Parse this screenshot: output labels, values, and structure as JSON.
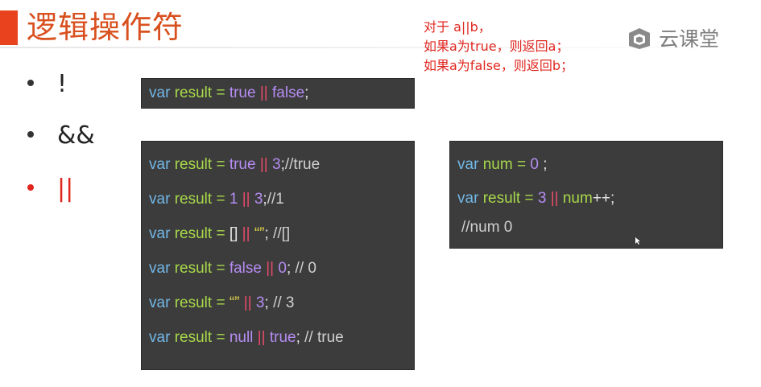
{
  "title": "逻辑操作符",
  "note_lines": [
    "对于 a||b，",
    "如果a为true，则返回a；",
    "如果a为false，则返回b；"
  ],
  "logo_text": "云课堂",
  "bullets": [
    {
      "label": "!"
    },
    {
      "label": "&&"
    },
    {
      "label": "||",
      "active": true
    }
  ],
  "box1": {
    "line": {
      "kw": "var",
      "id": "result",
      "eq": "=",
      "a": "true",
      "or": "||",
      "b": "false",
      "end": ";"
    }
  },
  "box2": {
    "lines": [
      {
        "kw": "var",
        "id": "result",
        "eq": "=",
        "a": "true",
        "or": "||",
        "b": "3",
        "end": ";",
        "comment": "//true"
      },
      {
        "kw": "var",
        "id": "result",
        "eq": "=",
        "a": "1",
        "or": "||",
        "b": "3",
        "end": ";",
        "comment": "//1"
      },
      {
        "kw": "var",
        "id": "result",
        "eq": "=",
        "a": "[]",
        "or": "||",
        "b": "“”",
        "end": ";",
        "comment": "//[]"
      },
      {
        "kw": "var",
        "id": "result",
        "eq": "=",
        "a": "false",
        "or": "||",
        "b": "0",
        "end": ";",
        "comment": "// 0"
      },
      {
        "kw": "var",
        "id": "result",
        "eq": "=",
        "a": "“”",
        "or": "||",
        "b": "3",
        "end": ";",
        "comment": "// 3"
      },
      {
        "kw": "var",
        "id": "result",
        "eq": "=",
        "a": "null",
        "or": "||",
        "b": "true",
        "end": ";",
        "comment": "// true"
      }
    ]
  },
  "box3": {
    "line1": {
      "kw": "var",
      "id": "num",
      "eq": "=",
      "val": "0",
      "end": ";"
    },
    "line2": {
      "kw": "var",
      "id": "result",
      "eq": "=",
      "a": "3",
      "or": "||",
      "b": "num",
      "inc": "++",
      "end": ";"
    },
    "line3": "//num 0"
  },
  "colors": {
    "accent": "#e8431e",
    "note": "#e0261f",
    "code_bg": "#3c3c3c"
  }
}
